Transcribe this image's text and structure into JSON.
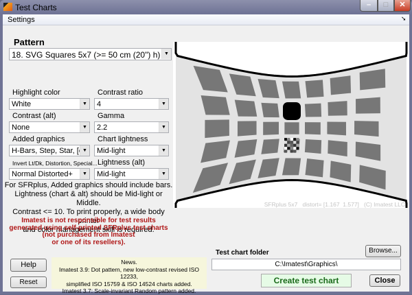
{
  "window": {
    "title": "Test Charts",
    "app_icon": "matlab-icon",
    "controls": [
      "minimize",
      "maximize",
      "close"
    ]
  },
  "menu": {
    "settings": "Settings",
    "dock_icon": "undock-arrow-icon"
  },
  "pattern": {
    "label": "Pattern",
    "value": "18. SVG Squares 5x7 (>= 50 cm (20\") h)"
  },
  "fields": [
    {
      "label": "Highlight color",
      "value": "White"
    },
    {
      "label": "Contrast ratio",
      "value": "4"
    },
    {
      "label": "Contrast (alt)",
      "value": "None"
    },
    {
      "label": "Gamma",
      "value": "2.2"
    },
    {
      "label": "Added graphics",
      "value": "H-Bars, Step, Star, [o]"
    },
    {
      "label": "Chart lightness",
      "value": "Mid-light"
    },
    {
      "label": "Invert Lt/Dk, Distortion, Special...",
      "value": "Normal Distorted+"
    },
    {
      "label": "Lightness (alt)",
      "value": "Mid-light"
    }
  ],
  "note": [
    "For SFRplus, Added graphics should include bars.",
    "Lightness (chart & alt) should be Mid-light or Middle.",
    "Contrast <= 10. To print properly, a wide body printer",
    "and color management skill is required."
  ],
  "warning": [
    "Imatest is not responsible for test results",
    "generated using self-printed SFRplus test charts",
    "(not purchased from Imatest",
    "or one of its resellers)."
  ],
  "news": [
    "News.",
    "Imatest 3.9: Dot pattern, new low-contrast revised ISO 12233,",
    "simplified ISO 15759 & ISO 14524 charts added.",
    "Imatest 3.7: Scale-invariant Random pattern added."
  ],
  "preview": {
    "caption": "SFRplus 5x7   distort= [1.167  1.577]   (C) Imatest LLC"
  },
  "buttons": {
    "help": "Help",
    "reset": "Reset",
    "browse": "Browse...",
    "create": "Create test chart",
    "close": "Close"
  },
  "folder": {
    "label": "Test chart folder",
    "value": "C:\\Imatest\\Graphics\\"
  },
  "colors": {
    "warning": "#b01818",
    "create_bg": "#e6fbe6",
    "create_text": "#1a6a1a",
    "news_bg": "#f6f6dc"
  }
}
